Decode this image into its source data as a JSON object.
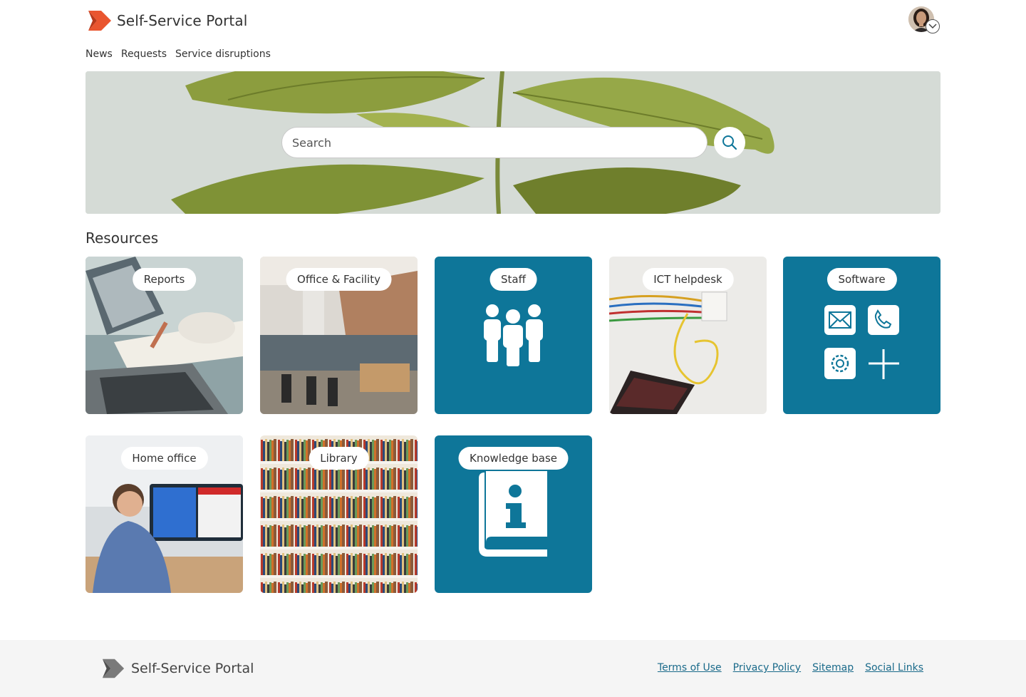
{
  "header": {
    "brand_title": "Self-Service Portal",
    "nav": [
      "News",
      "Requests",
      "Service disruptions"
    ]
  },
  "search": {
    "placeholder": "Search"
  },
  "resources": {
    "title": "Resources",
    "tiles": [
      {
        "label": "Reports"
      },
      {
        "label": "Office & Facility"
      },
      {
        "label": "Staff"
      },
      {
        "label": "ICT helpdesk"
      },
      {
        "label": "Software"
      },
      {
        "label": "Home office"
      },
      {
        "label": "Library"
      },
      {
        "label": "Knowledge base"
      }
    ]
  },
  "footer": {
    "brand_title": "Self-Service Portal",
    "links": [
      "Terms of Use",
      "Privacy Policy",
      "Sitemap",
      "Social Links"
    ]
  },
  "colors": {
    "accent": "#0e7699",
    "brand_orange": "#e9552f",
    "link": "#1a6a8a"
  },
  "icons": {
    "brand": "chevron-logo-icon",
    "search": "search-icon",
    "avatar_caret": "chevron-down-icon"
  }
}
